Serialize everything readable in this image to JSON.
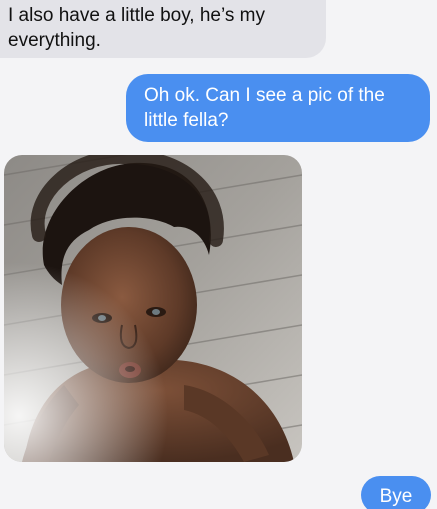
{
  "thread": {
    "messages": [
      {
        "direction": "incoming",
        "text": "I also have a little boy, he’s my everything."
      },
      {
        "direction": "outgoing",
        "text": "Oh ok. Can I see a pic of the little fella?"
      },
      {
        "direction": "incoming",
        "attachment": "photo-of-toddler"
      },
      {
        "direction": "outgoing",
        "text": "Bye"
      }
    ]
  },
  "colors": {
    "background": "#f4f4f6",
    "incoming_bubble": "#e3e3e8",
    "outgoing_bubble": "#4a8ff0"
  }
}
